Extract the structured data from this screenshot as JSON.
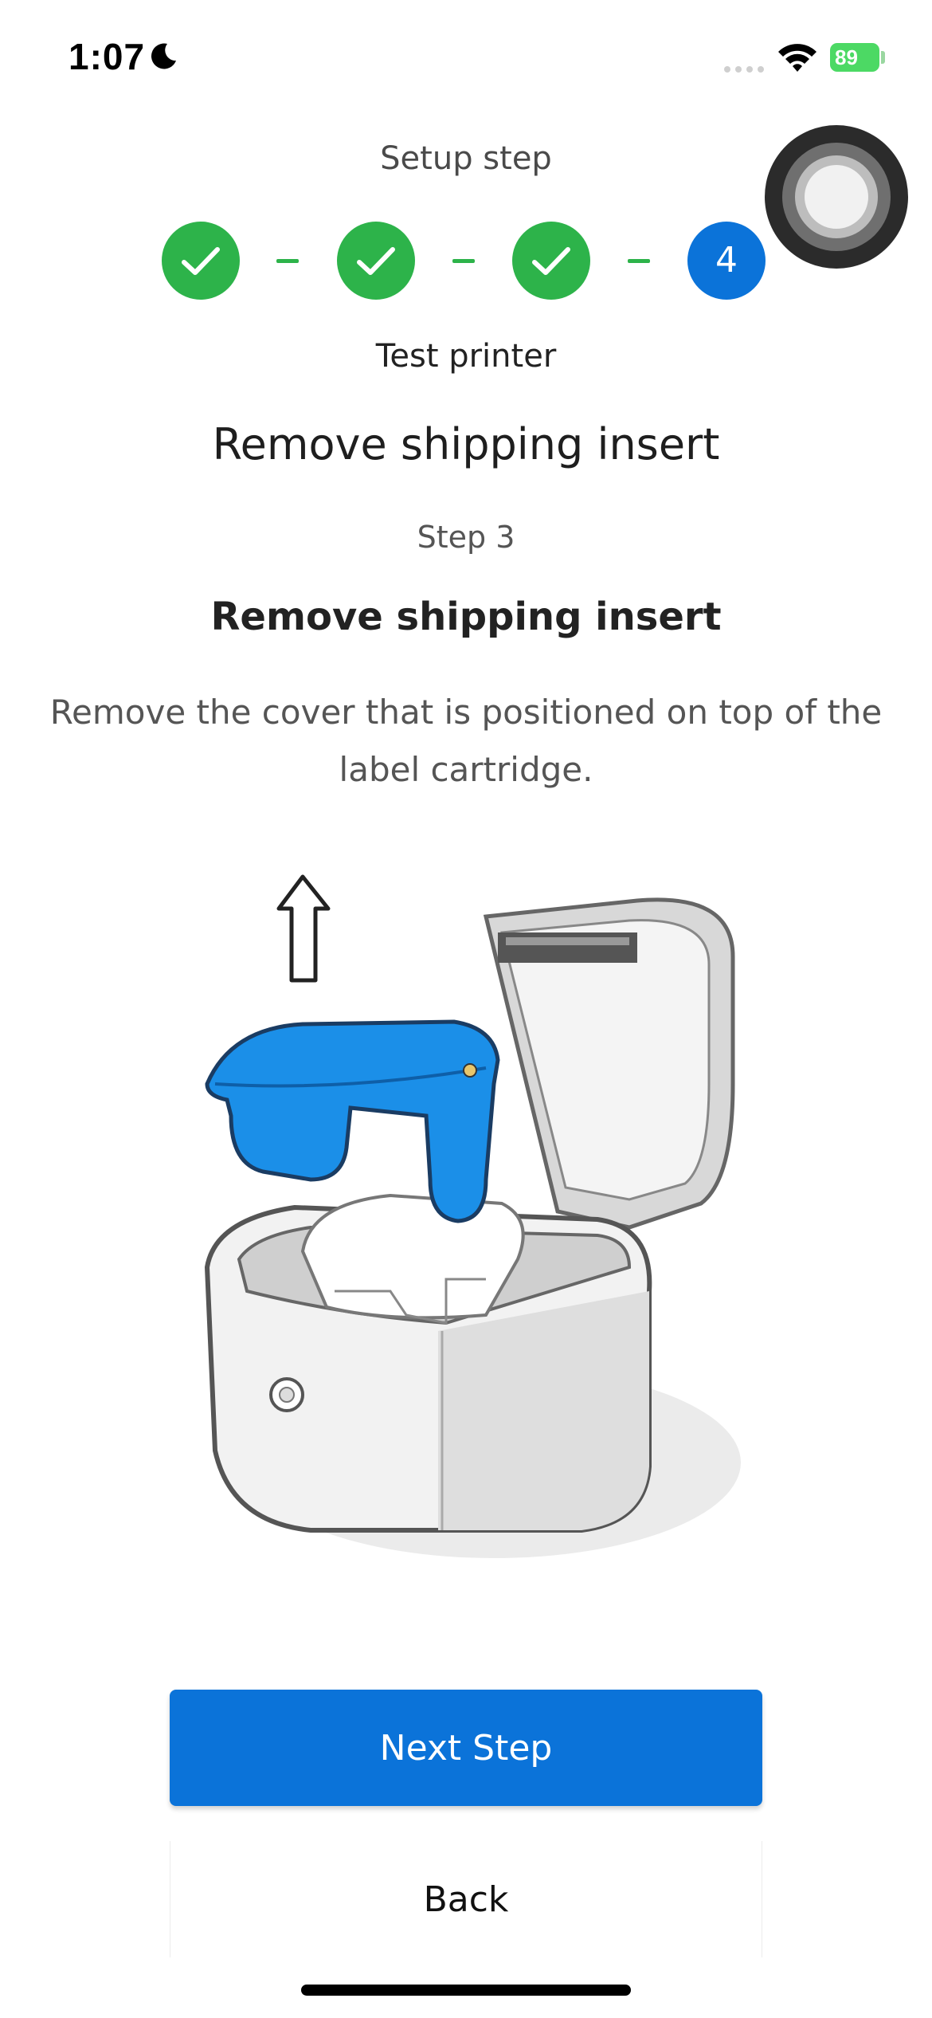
{
  "status_bar": {
    "time": "1:07",
    "battery": "89"
  },
  "header": {
    "label": "Setup step"
  },
  "stepper": {
    "steps": [
      {
        "state": "done"
      },
      {
        "state": "done"
      },
      {
        "state": "done"
      },
      {
        "state": "current",
        "number": "4"
      }
    ],
    "current_step_name": "Test printer"
  },
  "page": {
    "title": "Remove shipping insert",
    "step_number": "Step 3",
    "instruction_title": "Remove shipping insert",
    "instruction_body": "Remove the cover that is positioned on top of the label cartridge."
  },
  "actions": {
    "next_label": "Next Step",
    "back_label": "Back"
  },
  "colors": {
    "primary": "#0b73d9",
    "success": "#2db34a",
    "insert_blue": "#1b8fe8"
  }
}
